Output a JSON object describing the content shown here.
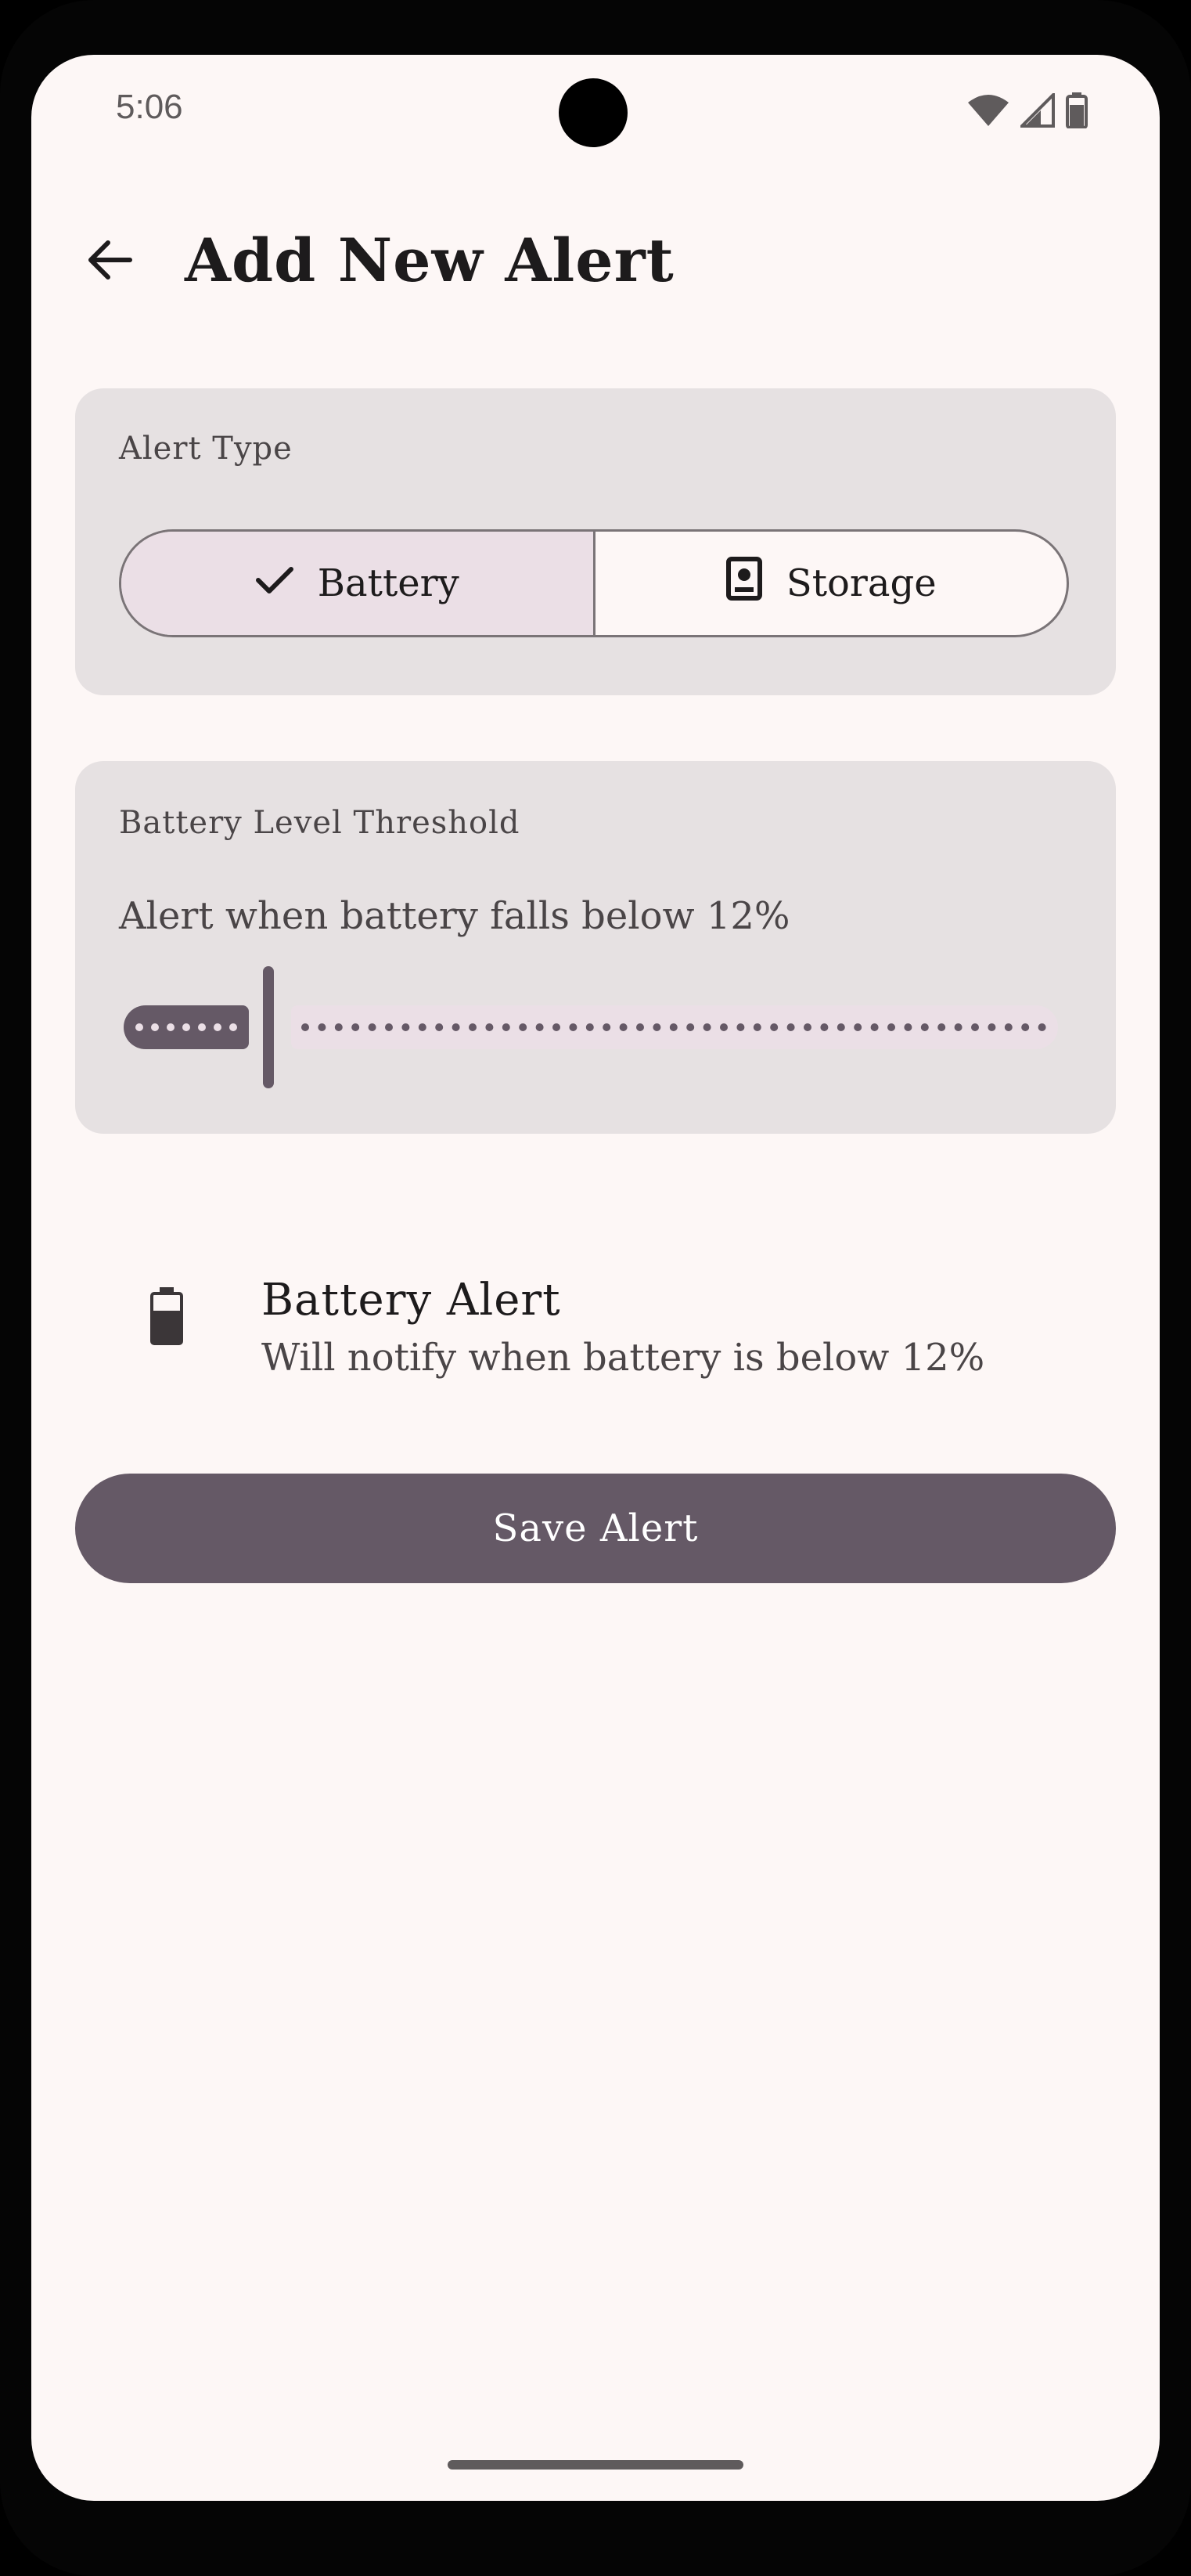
{
  "status_bar": {
    "time": "5:06",
    "icons": [
      "wifi-icon",
      "cellular-signal-icon",
      "battery-icon"
    ]
  },
  "app_bar": {
    "back_icon": "arrow-back-icon",
    "title": "Add New Alert"
  },
  "alert_type": {
    "label": "Alert Type",
    "options": [
      {
        "label": "Battery",
        "icon": "check-icon",
        "selected": true
      },
      {
        "label": "Storage",
        "icon": "storage-icon",
        "selected": false
      }
    ]
  },
  "threshold": {
    "label": "Battery Level Threshold",
    "description": "Alert when battery falls below 12%",
    "slider_value_percent": 12,
    "slider_min": 0,
    "slider_max": 100
  },
  "summary": {
    "icon": "battery-icon",
    "title": "Battery Alert",
    "subtitle": "Will notify when battery is below 12%"
  },
  "save_button": {
    "label": "Save Alert"
  },
  "colors": {
    "background": "#FDF7F6",
    "card": "#E6E1E2",
    "primary": "#655966",
    "selected_segment": "#EBDFE6",
    "text_primary": "#1d1b1c",
    "text_secondary": "#4a4547"
  }
}
